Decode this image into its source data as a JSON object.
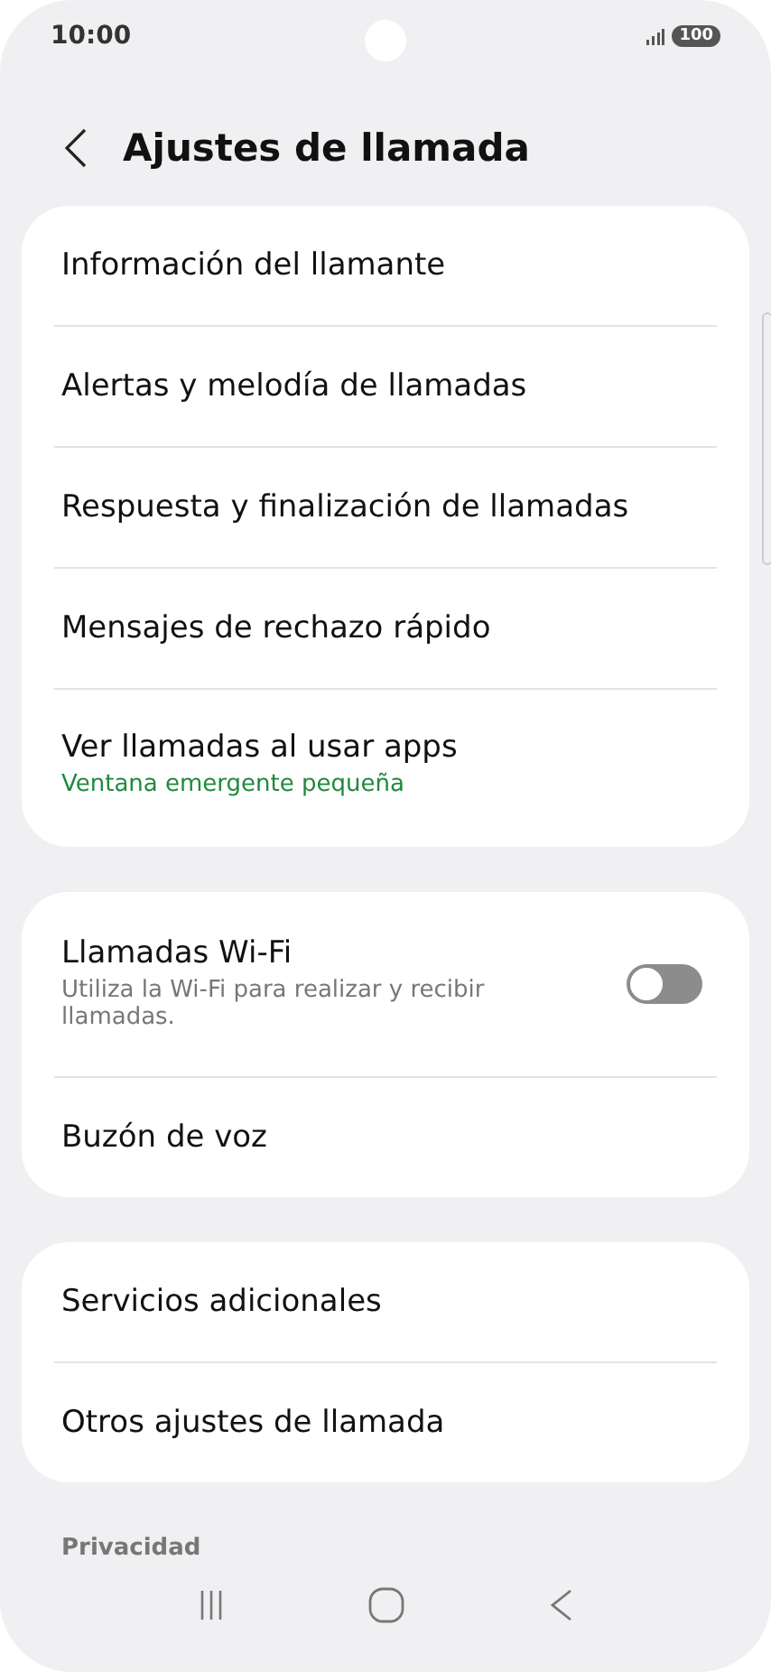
{
  "status_bar": {
    "time": "10:00",
    "battery": "100"
  },
  "header": {
    "title": "Ajustes de llamada"
  },
  "groups": [
    {
      "items": [
        {
          "kind": "link",
          "title": "Información del llamante"
        },
        {
          "kind": "link",
          "title": "Alertas y melodía de llamadas"
        },
        {
          "kind": "link",
          "title": "Respuesta y finalización de llamadas"
        },
        {
          "kind": "link",
          "title": "Mensajes de rechazo rápido"
        },
        {
          "kind": "summary",
          "title": "Ver llamadas al usar apps",
          "subtitle": "Ventana emergente pequeña"
        }
      ]
    },
    {
      "items": [
        {
          "kind": "toggle",
          "title": "Llamadas Wi-Fi",
          "subtitle": "Utiliza la Wi-Fi para realizar y recibir llamadas.",
          "on": false
        },
        {
          "kind": "link",
          "title": "Buzón de voz"
        }
      ]
    },
    {
      "items": [
        {
          "kind": "link",
          "title": "Servicios adicionales"
        },
        {
          "kind": "link",
          "title": "Otros ajustes de llamada"
        }
      ]
    }
  ],
  "section_header": "Privacidad"
}
